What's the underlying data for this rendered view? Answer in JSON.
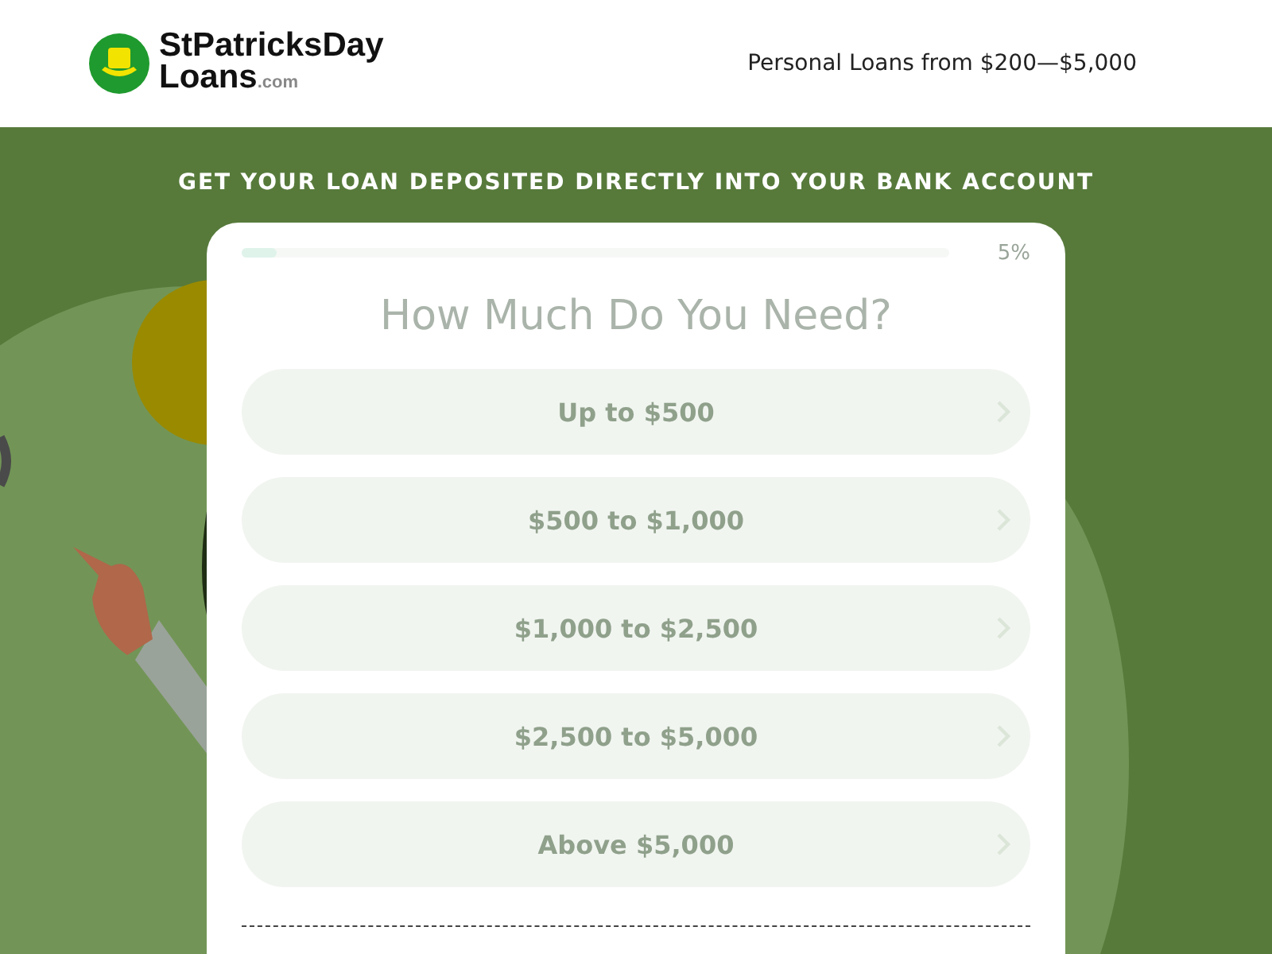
{
  "header": {
    "logo": {
      "name": "StPatricksDay",
      "line2": "Loans",
      "suffix": ".com"
    },
    "tagline": "Personal Loans from $200—$5,000"
  },
  "banner": {
    "heading": "GET YOUR LOAN DEPOSITED DIRECTLY INTO YOUR BANK ACCOUNT"
  },
  "form": {
    "progress": {
      "level": 0.05,
      "reading": "5%"
    },
    "question": "How Much Do You Need?",
    "options": [
      {
        "label": "Up to $500"
      },
      {
        "label": "$500 to $1,000"
      },
      {
        "label": "$1,000 to $2,500"
      },
      {
        "label": "$2,500 to $5,000"
      },
      {
        "label": "Above $5,000"
      }
    ]
  }
}
